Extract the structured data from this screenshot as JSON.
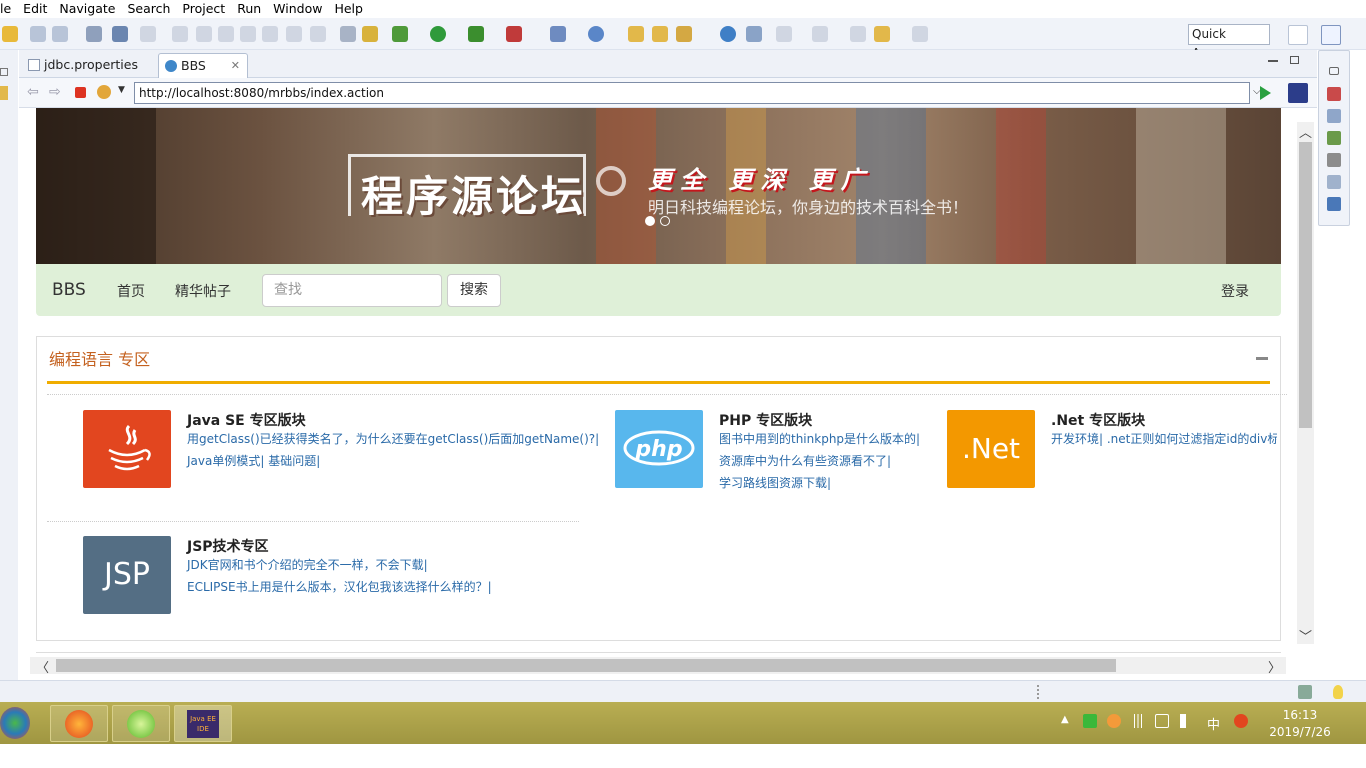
{
  "menu": [
    "le",
    "Edit",
    "Navigate",
    "Search",
    "Project",
    "Run",
    "Window",
    "Help"
  ],
  "toolbar": {
    "quick_access": "Quick Access"
  },
  "tabs": [
    {
      "label": "jdbc.properties",
      "active": false
    },
    {
      "label": "BBS",
      "active": true,
      "close": "✕"
    }
  ],
  "browser": {
    "url": "http://localhost:8080/mrbbs/index.action"
  },
  "banner": {
    "title": "程序源论坛",
    "slogan": "更全 更深 更广",
    "subtitle": "明日科技编程论坛，你身边的技术百科全书！"
  },
  "nav": {
    "brand": "BBS",
    "links": [
      "首页",
      "精华帖子"
    ],
    "search_placeholder": "查找",
    "search_button": "搜索",
    "login": "登录"
  },
  "section": {
    "title": "编程语言 专区",
    "forums": [
      {
        "logo": "java",
        "name": "Java SE 专区版块",
        "posts": [
          "用getClass()已经获得类名了，为什么还要在getClass()后面加getName()?|",
          "Java单例模式| 基础问题|"
        ],
        "color": "#e2461f"
      },
      {
        "logo": "php",
        "name": "PHP 专区版块",
        "posts": [
          "图书中用到的thinkphp是什么版本的|",
          "资源库中为什么有些资源看不了|",
          "学习路线图资源下载|"
        ],
        "color": "#58b7ed"
      },
      {
        "logo": ".Net",
        "name": ".Net 专区版块",
        "posts": [
          "开发环境| .net正则如何过滤指定id的div标签| .n"
        ],
        "color": "#f39800"
      },
      {
        "logo": "JSP",
        "name": "JSP技术专区",
        "posts": [
          "JDK官网和书个介绍的完全不一样，不会下载|",
          "ECLIPSE书上用是什么版本，汉化包我该选择什么样的？|"
        ],
        "color": "#546e84"
      }
    ]
  },
  "taskbar": {
    "clock_time": "16:13",
    "clock_date": "2019/7/26",
    "ime": "中",
    "eclipse_label": "Java EE IDE"
  }
}
